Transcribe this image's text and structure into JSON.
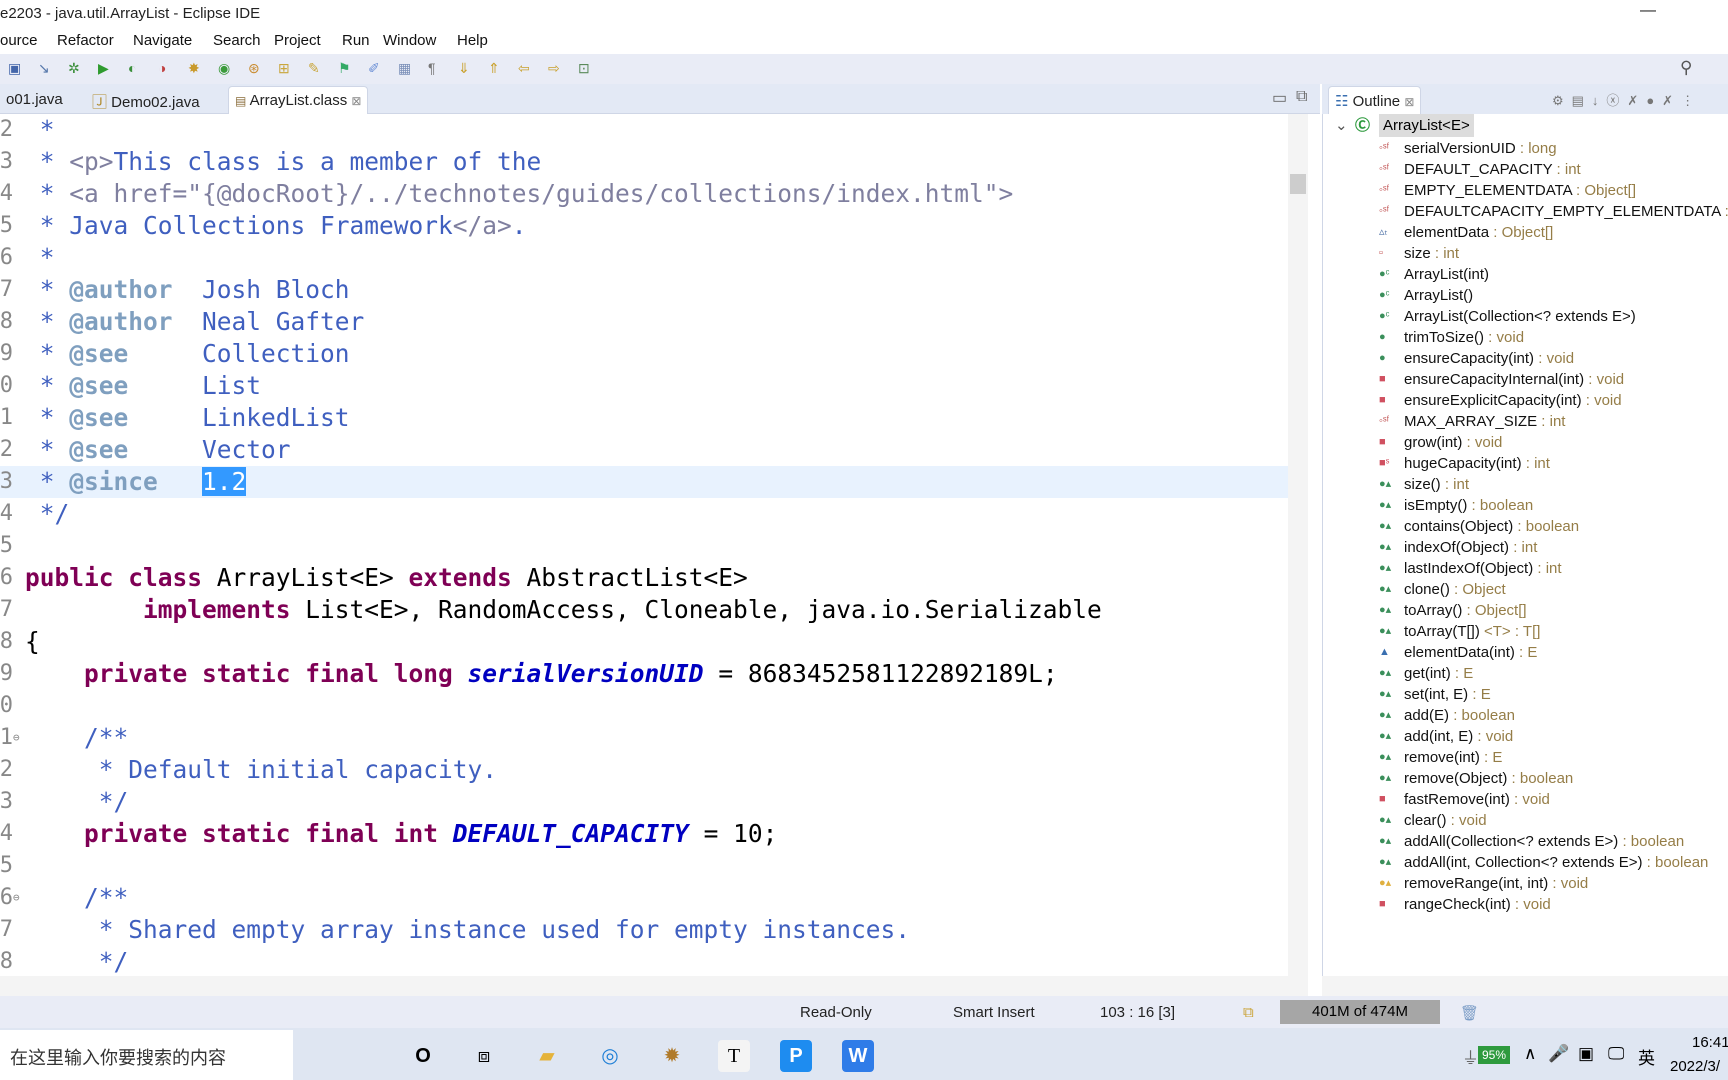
{
  "window": {
    "title": "e2203 - java.util.ArrayList - Eclipse IDE",
    "minimize": "—"
  },
  "menu": [
    "ource",
    "Refactor",
    "Navigate",
    "Search",
    "Project",
    "Run",
    "Window",
    "Help"
  ],
  "toolbar": {
    "icons": [
      "save-icon",
      "skip-breakpoints-icon",
      "debug-icon",
      "run-icon",
      "coverage-icon",
      "external-tools-icon",
      "new-java-project-icon",
      "new-class-icon",
      "open-type-icon",
      "open-resource-icon",
      "search-icon",
      "toggle-breadcrumb-icon",
      "mark-occurrences-icon",
      "block-selection-icon",
      "show-whitespace-icon",
      "next-annotation-icon",
      "previous-annotation-icon",
      "back-icon",
      "forward-icon",
      "pin-editor-icon"
    ]
  },
  "tabs": [
    {
      "label": "o01.java"
    },
    {
      "label": "Demo02.java"
    },
    {
      "label": "ArrayList.class",
      "active": true,
      "close": "⊠"
    }
  ],
  "editor": {
    "lines": [
      {
        "n": "2",
        "t": [
          [
            "jd",
            " *"
          ]
        ]
      },
      {
        "n": "3",
        "t": [
          [
            "jd",
            " * "
          ],
          [
            "html",
            "<p>"
          ],
          [
            "jd",
            "This class is a member of the"
          ]
        ]
      },
      {
        "n": "4",
        "t": [
          [
            "jd",
            " * "
          ],
          [
            "html",
            "<a href=\"{@docRoot}/../technotes/guides/collections/index.html\">"
          ]
        ]
      },
      {
        "n": "5",
        "t": [
          [
            "jd",
            " * Java Collections Framework"
          ],
          [
            "html",
            "</a>"
          ],
          [
            "jd",
            "."
          ]
        ]
      },
      {
        "n": "6",
        "t": [
          [
            "jd",
            " *"
          ]
        ]
      },
      {
        "n": "7",
        "t": [
          [
            "jd",
            " * "
          ],
          [
            "tag",
            "@author"
          ],
          [
            "jd",
            "  Josh Bloch"
          ]
        ]
      },
      {
        "n": "8",
        "t": [
          [
            "jd",
            " * "
          ],
          [
            "tag",
            "@author"
          ],
          [
            "jd",
            "  Neal Gafter"
          ]
        ]
      },
      {
        "n": "9",
        "t": [
          [
            "jd",
            " * "
          ],
          [
            "tag",
            "@see"
          ],
          [
            "jd",
            "     Collection"
          ]
        ]
      },
      {
        "n": "0",
        "t": [
          [
            "jd",
            " * "
          ],
          [
            "tag",
            "@see"
          ],
          [
            "jd",
            "     List"
          ]
        ]
      },
      {
        "n": "1",
        "t": [
          [
            "jd",
            " * "
          ],
          [
            "tag",
            "@see"
          ],
          [
            "jd",
            "     LinkedList"
          ]
        ]
      },
      {
        "n": "2",
        "t": [
          [
            "jd",
            " * "
          ],
          [
            "tag",
            "@see"
          ],
          [
            "jd",
            "     Vector"
          ]
        ]
      },
      {
        "n": "3",
        "cur": true,
        "t": [
          [
            "jd",
            " * "
          ],
          [
            "tag",
            "@since"
          ],
          [
            "jd",
            "   "
          ],
          [
            "sel",
            "1.2"
          ]
        ]
      },
      {
        "n": "4",
        "t": [
          [
            "jd",
            " */"
          ]
        ]
      },
      {
        "n": "5",
        "t": []
      },
      {
        "n": "6",
        "t": [
          [
            "kw",
            "public class"
          ],
          [
            "plain",
            " ArrayList<E> "
          ],
          [
            "kw",
            "extends"
          ],
          [
            "plain",
            " AbstractList<E>"
          ]
        ]
      },
      {
        "n": "7",
        "t": [
          [
            "plain",
            "        "
          ],
          [
            "kw",
            "implements"
          ],
          [
            "plain",
            " List<E>, RandomAccess, Cloneable, java.io.Serializable"
          ]
        ]
      },
      {
        "n": "8",
        "t": [
          [
            "plain",
            "{"
          ]
        ]
      },
      {
        "n": "9",
        "t": [
          [
            "plain",
            "    "
          ],
          [
            "kw",
            "private static final long"
          ],
          [
            "plain",
            " "
          ],
          [
            "field",
            "serialVersionUID"
          ],
          [
            "plain",
            " = 8683452581122892189L;"
          ]
        ]
      },
      {
        "n": "0",
        "t": []
      },
      {
        "n": "1",
        "fold": "⊖",
        "t": [
          [
            "jd",
            "    /**"
          ]
        ]
      },
      {
        "n": "2",
        "t": [
          [
            "jd",
            "     * Default initial capacity."
          ]
        ]
      },
      {
        "n": "3",
        "t": [
          [
            "jd",
            "     */"
          ]
        ]
      },
      {
        "n": "4",
        "t": [
          [
            "plain",
            "    "
          ],
          [
            "kw",
            "private static final int"
          ],
          [
            "plain",
            " "
          ],
          [
            "field",
            "DEFAULT_CAPACITY"
          ],
          [
            "plain",
            " = 10;"
          ]
        ]
      },
      {
        "n": "5",
        "t": []
      },
      {
        "n": "6",
        "fold": "⊖",
        "t": [
          [
            "jd",
            "    /**"
          ]
        ]
      },
      {
        "n": "7",
        "t": [
          [
            "jd",
            "     * Shared empty array instance used for empty instances."
          ]
        ]
      },
      {
        "n": "8",
        "t": [
          [
            "jd",
            "     */"
          ]
        ]
      }
    ]
  },
  "outline": {
    "title": "Outline",
    "close": "⊠",
    "root": "ArrayList<E>",
    "items": [
      {
        "icon": "sf",
        "name": "serialVersionUID",
        "type": " : long"
      },
      {
        "icon": "sf",
        "name": "DEFAULT_CAPACITY",
        "type": " : int"
      },
      {
        "icon": "sf",
        "name": "EMPTY_ELEMENTDATA",
        "type": " : Object[]"
      },
      {
        "icon": "sf",
        "name": "DEFAULTCAPACITY_EMPTY_ELEMENTDATA",
        "type": " :"
      },
      {
        "icon": "dt",
        "name": "elementData",
        "type": " : Object[]"
      },
      {
        "icon": "pf",
        "name": "size",
        "type": " : int"
      },
      {
        "icon": "c",
        "name": "ArrayList(int)",
        "type": ""
      },
      {
        "icon": "c",
        "name": "ArrayList()",
        "type": ""
      },
      {
        "icon": "c",
        "name": "ArrayList(Collection<? extends E>)",
        "type": ""
      },
      {
        "icon": "pub",
        "name": "trimToSize()",
        "type": " : void"
      },
      {
        "icon": "pub",
        "name": "ensureCapacity(int)",
        "type": " : void"
      },
      {
        "icon": "priv",
        "name": "ensureCapacityInternal(int)",
        "type": " : void"
      },
      {
        "icon": "priv",
        "name": "ensureExplicitCapacity(int)",
        "type": " : void"
      },
      {
        "icon": "sf",
        "name": "MAX_ARRAY_SIZE",
        "type": " : int"
      },
      {
        "icon": "priv",
        "name": "grow(int)",
        "type": " : void"
      },
      {
        "icon": "privs",
        "name": "hugeCapacity(int)",
        "type": " : int"
      },
      {
        "icon": "ov",
        "name": "size()",
        "type": " : int"
      },
      {
        "icon": "ov",
        "name": "isEmpty()",
        "type": " : boolean"
      },
      {
        "icon": "ov",
        "name": "contains(Object)",
        "type": " : boolean"
      },
      {
        "icon": "ov",
        "name": "indexOf(Object)",
        "type": " : int"
      },
      {
        "icon": "ov",
        "name": "lastIndexOf(Object)",
        "type": " : int"
      },
      {
        "icon": "ov",
        "name": "clone()",
        "type": " : Object"
      },
      {
        "icon": "ov",
        "name": "toArray()",
        "type": " : Object[]"
      },
      {
        "icon": "ov",
        "name": "toArray(T[])",
        "type": " <T> : T[]"
      },
      {
        "icon": "def",
        "name": "elementData(int)",
        "type": " : E"
      },
      {
        "icon": "ov",
        "name": "get(int)",
        "type": " : E"
      },
      {
        "icon": "ov",
        "name": "set(int, E)",
        "type": " : E"
      },
      {
        "icon": "ov",
        "name": "add(E)",
        "type": " : boolean"
      },
      {
        "icon": "ov",
        "name": "add(int, E)",
        "type": " : void"
      },
      {
        "icon": "ov",
        "name": "remove(int)",
        "type": " : E"
      },
      {
        "icon": "ov",
        "name": "remove(Object)",
        "type": " : boolean"
      },
      {
        "icon": "priv",
        "name": "fastRemove(int)",
        "type": " : void"
      },
      {
        "icon": "ov",
        "name": "clear()",
        "type": " : void"
      },
      {
        "icon": "ov",
        "name": "addAll(Collection<? extends E>)",
        "type": " : boolean"
      },
      {
        "icon": "ov",
        "name": "addAll(int, Collection<? extends E>)",
        "type": " : boolean"
      },
      {
        "icon": "prot",
        "name": "removeRange(int, int)",
        "type": " : void"
      },
      {
        "icon": "priv",
        "name": "rangeCheck(int)",
        "type": " : void"
      }
    ]
  },
  "status": {
    "mode": "Read-Only",
    "insert": "Smart Insert",
    "position": "103 : 16 [3]",
    "memory": "401M of 474M"
  },
  "taskbar": {
    "search_placeholder": "在这里输入你要搜索的内容",
    "battery": "95%",
    "ime": "英",
    "time": "16:41",
    "date": "2022/3/"
  },
  "colors": {
    "keyword": "#7f0055",
    "javadoc": "#3f5fbf",
    "field": "#0000c0",
    "selection": "#3399ff",
    "current_line": "#e8f2fe"
  }
}
